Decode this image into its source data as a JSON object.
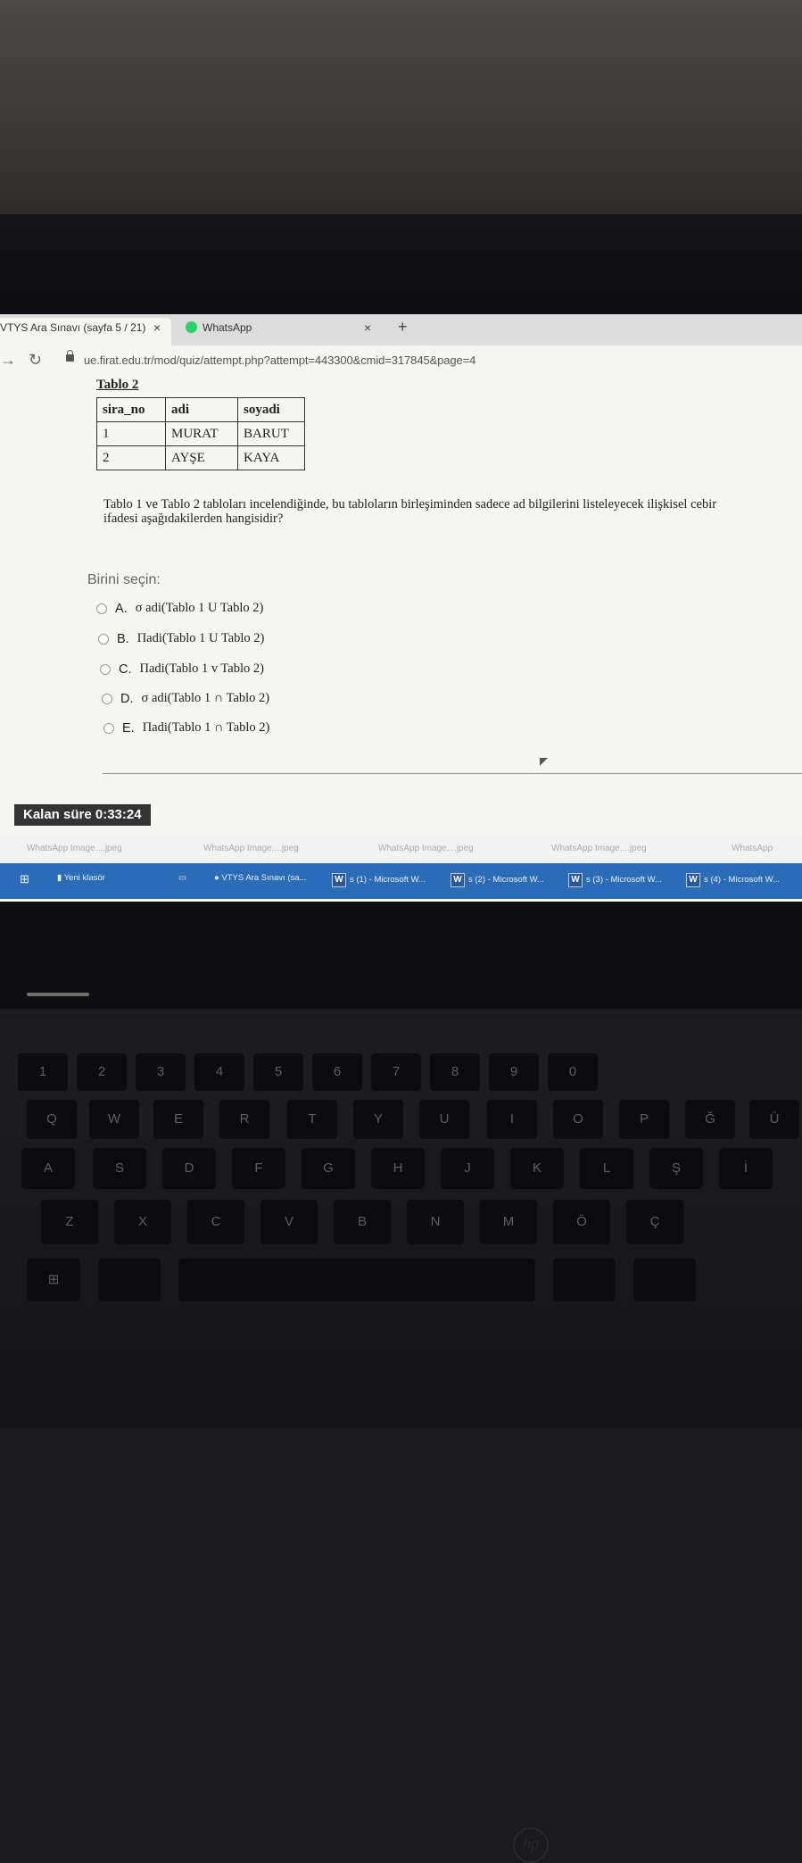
{
  "browser": {
    "tabs": [
      {
        "label": "VTYS Ara Sınavı (sayfa 5 / 21)",
        "close": "×"
      },
      {
        "label": "WhatsApp",
        "close": "×"
      }
    ],
    "new_tab": "+",
    "url": "ue.firat.edu.tr/mod/quiz/attempt.php?attempt=443300&cmid=317845&page=4"
  },
  "quiz": {
    "table_title": "Tablo 2",
    "table": {
      "headers": [
        "sira_no",
        "adi",
        "soyadi"
      ],
      "rows": [
        [
          "1",
          "MURAT",
          "BARUT"
        ],
        [
          "2",
          "AYŞE",
          "KAYA"
        ]
      ]
    },
    "question": "Tablo 1 ve Tablo 2 tabloları incelendiğinde, bu tabloların birleşiminden sadece ad bilgilerini listeleyecek ilişkisel cebir ifadesi aşağıdakilerden hangisidir?",
    "prompt": "Birini seçin:",
    "options": [
      {
        "letter": "A.",
        "text": "σ adi(Tablo 1 U Tablo 2)"
      },
      {
        "letter": "B.",
        "text": "Πadi(Tablo 1 U Tablo 2)"
      },
      {
        "letter": "C.",
        "text": "Πadi(Tablo 1 v Tablo 2)"
      },
      {
        "letter": "D.",
        "text": "σ adi(Tablo 1 ∩ Tablo 2)"
      },
      {
        "letter": "E.",
        "text": "Πadi(Tablo 1 ∩ Tablo 2)"
      }
    ],
    "timer": "Kalan süre 0:33:24"
  },
  "downloads": [
    "WhatsApp Image....jpeg",
    "WhatsApp Image....jpeg",
    "WhatsApp Image....jpeg",
    "WhatsApp Image....jpeg",
    "WhatsApp"
  ],
  "taskbar": {
    "folder": "Yeni klasör",
    "chrome": "VTYS Ara Sınavı (sa...",
    "word_icon": "W",
    "word": [
      "s (1) - Microsoft W...",
      "s (2) - Microsoft W...",
      "s (3) - Microsoft W...",
      "s (4) - Microsoft W..."
    ]
  },
  "keyboard": {
    "row1": [
      "1",
      "2",
      "3",
      "4",
      "5",
      "6",
      "7",
      "8",
      "9",
      "0"
    ],
    "row2": [
      "Q",
      "W",
      "E",
      "R",
      "T",
      "Y",
      "U",
      "I",
      "O",
      "P",
      "Ğ",
      "Ü"
    ],
    "row3": [
      "A",
      "S",
      "D",
      "F",
      "G",
      "H",
      "J",
      "K",
      "L",
      "Ş",
      "İ"
    ],
    "row4": [
      "Z",
      "X",
      "C",
      "V",
      "B",
      "N",
      "M",
      "Ö",
      "Ç"
    ]
  },
  "colors": {
    "taskbar": "#2a6cb5",
    "whatsapp": "#25d366",
    "timer_bg": "#333333"
  }
}
